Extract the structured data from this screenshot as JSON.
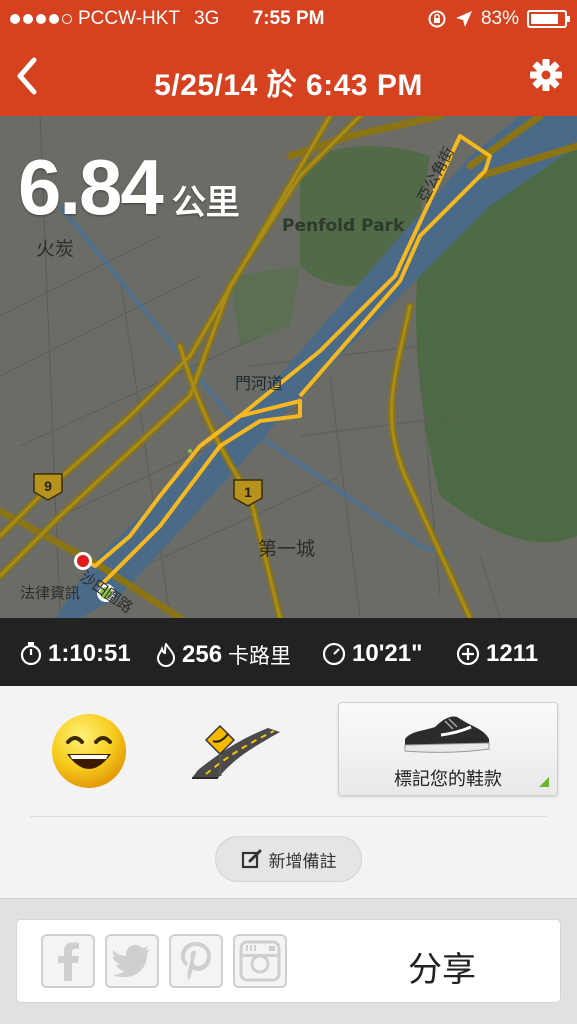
{
  "status_bar": {
    "carrier": "PCCW-HKT",
    "network": "3G",
    "time": "7:55 PM",
    "battery": "83%",
    "battery_level": 0.83
  },
  "nav": {
    "title": "5/25/14 於 6:43 PM"
  },
  "map": {
    "distance_value": "6.84",
    "distance_unit": "公里",
    "labels": {
      "park": "Penfold Park",
      "huotan": "火炭",
      "river": "門河道",
      "first_city": "第一城",
      "law": "法律資訊",
      "street_right": "亞公角街",
      "road": "沙田圍路",
      "route_9": "9",
      "route_1": "1"
    },
    "route_color": "#f5b820",
    "start_color": "#8cc63f",
    "end_color": "#e01b1b"
  },
  "stats": {
    "duration": "1:10:51",
    "calories": "256",
    "calories_unit": "卡路里",
    "pace": "10'21\"",
    "fuel": "1211"
  },
  "actions": {
    "tag_shoes_label": "標記您的鞋款",
    "add_note_label": "新增備註"
  },
  "share": {
    "label": "分享"
  },
  "colors": {
    "header": "#d6411f",
    "stats_bar": "#222222",
    "map_bg": "#6c6c66"
  }
}
